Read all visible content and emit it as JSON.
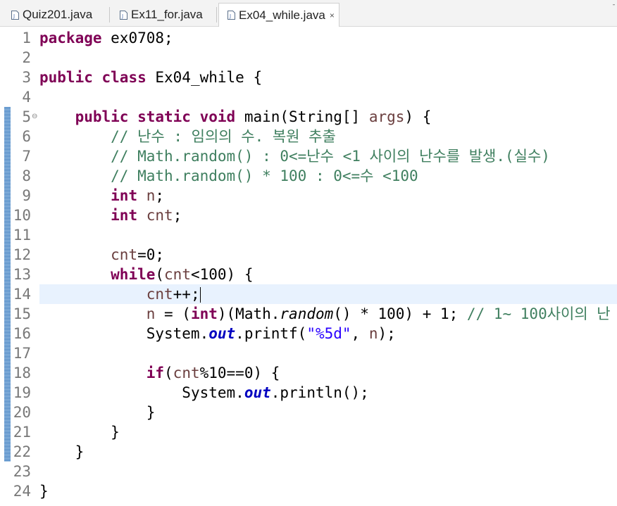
{
  "tabs": [
    {
      "label": "Quiz201.java",
      "active": false
    },
    {
      "label": "Ex11_for.java",
      "active": false
    },
    {
      "label": "Ex04_while.java",
      "active": true,
      "close_icon": "×"
    }
  ],
  "window_control_glyph": "¯",
  "editor": {
    "current_line": 14,
    "lines": [
      {
        "n": "1",
        "tokens": [
          {
            "t": "package",
            "c": "kw"
          },
          {
            "t": " ex0708;",
            "c": ""
          }
        ]
      },
      {
        "n": "2",
        "tokens": []
      },
      {
        "n": "3",
        "tokens": [
          {
            "t": "public",
            "c": "kw"
          },
          {
            "t": " ",
            "c": ""
          },
          {
            "t": "class",
            "c": "kw"
          },
          {
            "t": " Ex04_while {",
            "c": ""
          }
        ]
      },
      {
        "n": "4",
        "tokens": []
      },
      {
        "n": "5",
        "fold": "⊖",
        "tokens": [
          {
            "t": "    ",
            "c": ""
          },
          {
            "t": "public",
            "c": "kw"
          },
          {
            "t": " ",
            "c": ""
          },
          {
            "t": "static",
            "c": "kw"
          },
          {
            "t": " ",
            "c": ""
          },
          {
            "t": "void",
            "c": "kw"
          },
          {
            "t": " main(String[] ",
            "c": ""
          },
          {
            "t": "args",
            "c": "vr"
          },
          {
            "t": ") {",
            "c": ""
          }
        ]
      },
      {
        "n": "6",
        "tokens": [
          {
            "t": "        ",
            "c": ""
          },
          {
            "t": "// 난수 : 임의의 수. 복원 추출",
            "c": "cm"
          }
        ]
      },
      {
        "n": "7",
        "tokens": [
          {
            "t": "        ",
            "c": ""
          },
          {
            "t": "// Math.random() : 0<=난수 <1 사이의 난수를 발생.(실수)",
            "c": "cm"
          }
        ]
      },
      {
        "n": "8",
        "tokens": [
          {
            "t": "        ",
            "c": ""
          },
          {
            "t": "// Math.random() * 100 : 0<=수 <100",
            "c": "cm"
          }
        ]
      },
      {
        "n": "9",
        "tokens": [
          {
            "t": "        ",
            "c": ""
          },
          {
            "t": "int",
            "c": "kw"
          },
          {
            "t": " ",
            "c": ""
          },
          {
            "t": "n",
            "c": "vr"
          },
          {
            "t": ";",
            "c": ""
          }
        ]
      },
      {
        "n": "10",
        "tokens": [
          {
            "t": "        ",
            "c": ""
          },
          {
            "t": "int",
            "c": "kw"
          },
          {
            "t": " ",
            "c": ""
          },
          {
            "t": "cnt",
            "c": "vr"
          },
          {
            "t": ";",
            "c": ""
          }
        ]
      },
      {
        "n": "11",
        "tokens": []
      },
      {
        "n": "12",
        "tokens": [
          {
            "t": "        ",
            "c": ""
          },
          {
            "t": "cnt",
            "c": "vr"
          },
          {
            "t": "=0;",
            "c": ""
          }
        ]
      },
      {
        "n": "13",
        "tokens": [
          {
            "t": "        ",
            "c": ""
          },
          {
            "t": "while",
            "c": "kw"
          },
          {
            "t": "(",
            "c": ""
          },
          {
            "t": "cnt",
            "c": "vr"
          },
          {
            "t": "<100) {",
            "c": ""
          }
        ]
      },
      {
        "n": "14",
        "tokens": [
          {
            "t": "            ",
            "c": ""
          },
          {
            "t": "cnt",
            "c": "vr"
          },
          {
            "t": "++;",
            "c": ""
          }
        ],
        "cursor": true
      },
      {
        "n": "15",
        "tokens": [
          {
            "t": "            ",
            "c": ""
          },
          {
            "t": "n",
            "c": "vr"
          },
          {
            "t": " = (",
            "c": ""
          },
          {
            "t": "int",
            "c": "kw"
          },
          {
            "t": ")(Math.",
            "c": ""
          },
          {
            "t": "random",
            "c": "it"
          },
          {
            "t": "() * 100) + 1; ",
            "c": ""
          },
          {
            "t": "// 1~ 100사이의 난",
            "c": "cm"
          }
        ]
      },
      {
        "n": "16",
        "tokens": [
          {
            "t": "            ",
            "c": ""
          },
          {
            "t": "System.",
            "c": ""
          },
          {
            "t": "out",
            "c": "fd"
          },
          {
            "t": ".printf(",
            "c": ""
          },
          {
            "t": "\"%5d\"",
            "c": "st"
          },
          {
            "t": ", ",
            "c": ""
          },
          {
            "t": "n",
            "c": "vr"
          },
          {
            "t": ");",
            "c": ""
          }
        ]
      },
      {
        "n": "17",
        "tokens": []
      },
      {
        "n": "18",
        "tokens": [
          {
            "t": "            ",
            "c": ""
          },
          {
            "t": "if",
            "c": "kw"
          },
          {
            "t": "(",
            "c": ""
          },
          {
            "t": "cnt",
            "c": "vr"
          },
          {
            "t": "%10==0) {",
            "c": ""
          }
        ]
      },
      {
        "n": "19",
        "tokens": [
          {
            "t": "                ",
            "c": ""
          },
          {
            "t": "System.",
            "c": ""
          },
          {
            "t": "out",
            "c": "fd"
          },
          {
            "t": ".println();",
            "c": ""
          }
        ]
      },
      {
        "n": "20",
        "tokens": [
          {
            "t": "            }",
            "c": ""
          }
        ]
      },
      {
        "n": "21",
        "tokens": [
          {
            "t": "        }",
            "c": ""
          }
        ]
      },
      {
        "n": "22",
        "tokens": [
          {
            "t": "    }",
            "c": ""
          }
        ]
      },
      {
        "n": "23",
        "tokens": []
      },
      {
        "n": "24",
        "tokens": [
          {
            "t": "}",
            "c": ""
          }
        ]
      }
    ]
  }
}
